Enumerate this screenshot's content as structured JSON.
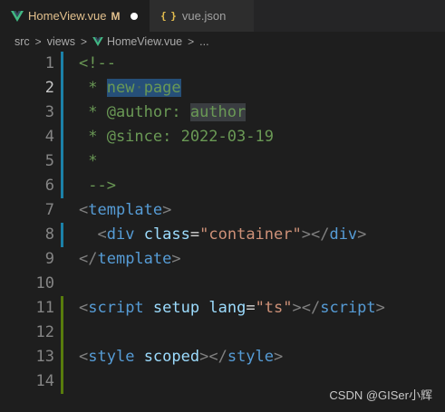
{
  "tabs": [
    {
      "label": "HomeView.vue",
      "badge": "M",
      "icon": "vue-icon",
      "active": true
    },
    {
      "label": "vue.json",
      "icon": "json-braces-icon",
      "icon_glyph": "{ }",
      "active": false
    }
  ],
  "breadcrumb": {
    "items": [
      "src",
      "views",
      "HomeView.vue",
      "..."
    ],
    "separator": ">"
  },
  "line_numbers": [
    "1",
    "2",
    "3",
    "4",
    "5",
    "6",
    "7",
    "8",
    "9",
    "10",
    "11",
    "12",
    "13",
    "14"
  ],
  "code": {
    "l1": {
      "text": "<!--"
    },
    "l2": {
      "prefix": " * ",
      "sel_a": "new",
      "sel_dot": "·",
      "sel_b": "page"
    },
    "l3": {
      "prefix": " * @author: ",
      "value": "author"
    },
    "l4": {
      "text": " * @since: 2022-03-19"
    },
    "l5": {
      "text": " *"
    },
    "l6": {
      "text": " -->"
    },
    "l7": {
      "open": "<",
      "tag": "template",
      "close": ">"
    },
    "l8": {
      "indent": "  ",
      "open": "<",
      "tag": "div",
      "space": " ",
      "attr": "class",
      "eq": "=",
      "str": "\"container\"",
      "close": "></",
      "endtag": "div",
      "end": ">"
    },
    "l9": {
      "open": "</",
      "tag": "template",
      "close": ">"
    },
    "l11": {
      "open": "<",
      "tag": "script",
      "space1": " ",
      "attr1": "setup",
      "space2": " ",
      "attr2": "lang",
      "eq": "=",
      "str": "\"ts\"",
      "close": "></",
      "endtag": "script",
      "end": ">"
    },
    "l13": {
      "open": "<",
      "tag": "style",
      "space": " ",
      "attr": "scoped",
      "close": "></",
      "endtag": "style",
      "end": ">"
    }
  },
  "watermark": "CSDN @GISer小辉",
  "colors": {
    "modified_tab": "#e2c08d",
    "vue_green": "#41b883",
    "gutter_modified": "#1b81a8",
    "gutter_added": "#587c0c"
  }
}
